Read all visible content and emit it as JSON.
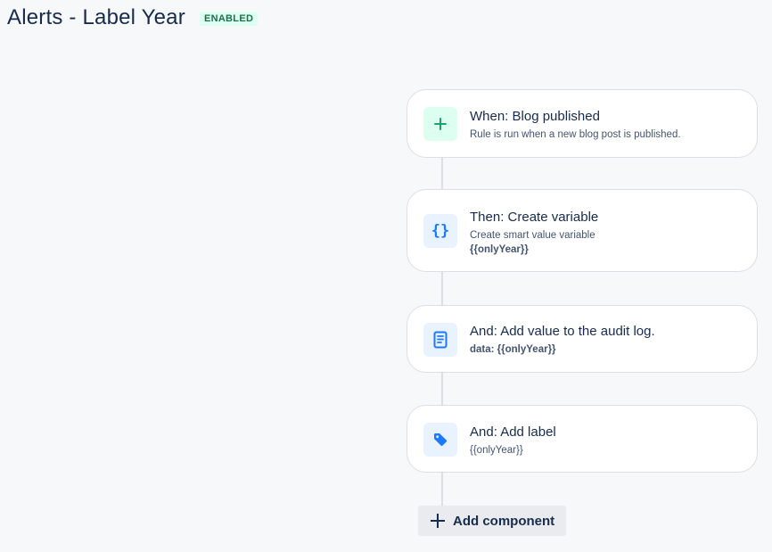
{
  "header": {
    "title": "Alerts - Label Year",
    "status": "ENABLED"
  },
  "components": [
    {
      "title": "When: Blog published",
      "subtitle": "Rule is run when a new blog post is published.",
      "detail": "",
      "icon": "plus-icon"
    },
    {
      "title": "Then: Create variable",
      "subtitle": "Create smart value variable",
      "detail": "{{onlyYear}}",
      "icon": "curly-braces-icon"
    },
    {
      "title": "And: Add value to the audit log.",
      "subtitle": "",
      "detail": "data: {{onlyYear}}",
      "icon": "document-icon"
    },
    {
      "title": "And: Add label",
      "subtitle": "{{onlyYear}}",
      "detail": "",
      "icon": "tag-icon"
    }
  ],
  "add_component": {
    "label": "Add component",
    "icon": "plus-icon"
  },
  "colors": {
    "accent_blue": "#1d7afc",
    "accent_green": "#22a06b",
    "badge_bg": "#dcfff1"
  }
}
